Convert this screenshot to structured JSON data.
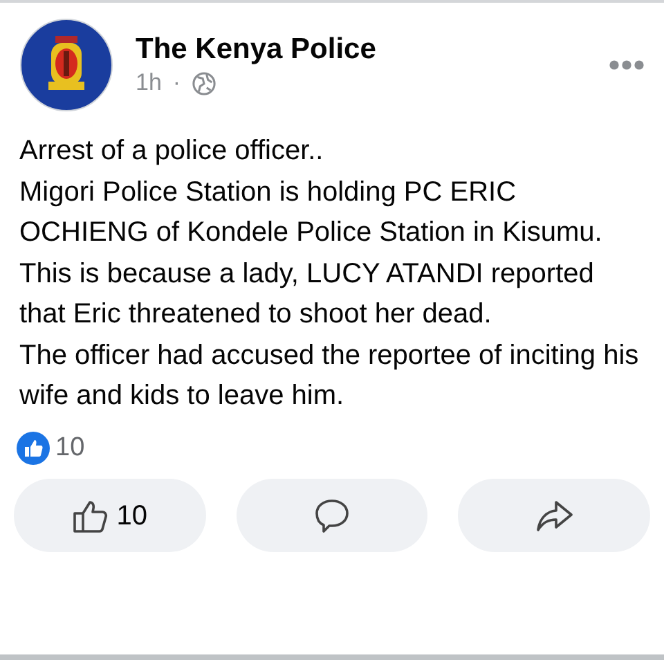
{
  "post": {
    "author": "The Kenya Police",
    "time": "1h",
    "separator": "·",
    "paragraphs": [
      "Arrest of a police officer..",
      "Migori Police Station is holding PC ERIC OCHIENG of Kondele Police Station in Kisumu.",
      "This is because a lady, LUCY ATANDI reported that Eric threatened to shoot her dead.",
      "The officer had accused the reportee of inciting his wife and kids to leave him."
    ],
    "reaction_count": "10",
    "actions": [
      {
        "kind": "like",
        "label": "10"
      },
      {
        "kind": "comment"
      },
      {
        "kind": "share"
      }
    ]
  }
}
